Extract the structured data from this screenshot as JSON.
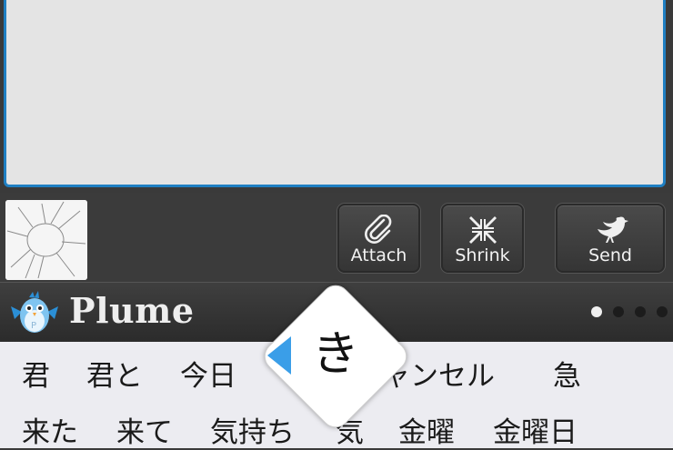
{
  "toolbar": {
    "attach_label": "Attach",
    "shrink_label": "Shrink",
    "send_label": "Send"
  },
  "brand": {
    "name": "Plume"
  },
  "pager": {
    "pages": 4,
    "active": 1
  },
  "keyboard": {
    "popup_char": "き",
    "candidates_row1": [
      "君",
      "君と",
      "今日",
      "",
      "ャンセル",
      "急"
    ],
    "candidates_row2": [
      "来た",
      "来て",
      "気持ち",
      "気",
      "金曜",
      "金曜日"
    ]
  },
  "colors": {
    "compose_border": "#1f7fc2",
    "popup_arrow": "#3a9ee8",
    "background": "#3a3a3a"
  }
}
